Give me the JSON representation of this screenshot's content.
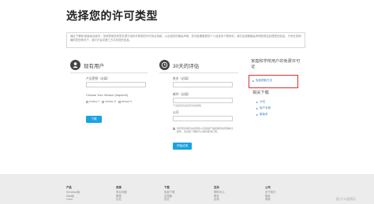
{
  "page": {
    "title": "选择您的许可类型"
  },
  "notice": {
    "text": "通过下载和/或使用此软件，您即表明您同意并遵守该软件附带的许可协议条款。以及相关的隐私声明，您可能需要提供个人信息来下载软件。我们会按照隐私声明的规定处理您的信息。只有在您明确同意的情况下，我们才会向第三方共享您的信息。"
  },
  "existing": {
    "title": "现有用户",
    "serial_label": "产品密钥（必填）",
    "version_label": "Choose Your Version (required)",
    "versions": [
      "Version 7",
      "Version 8",
      "Version 9"
    ],
    "download_label": "下载"
  },
  "trial": {
    "title": "30天的评估",
    "name_label": "姓名（必填）",
    "email_label": "邮件（必填）",
    "email_hint": "下载链接将发送至您的邮箱",
    "company_label": "公司",
    "consent_text": "我同意接收有关此软件以及其他产品和服务的营销电子邮件，并且我了解我可以随时取消订阅。",
    "start_label": "开始试用"
  },
  "sidebar": {
    "free_title": "家庭和学校用户的免费许可证",
    "free_link": "免费获取方法",
    "related_title": "相关下载",
    "related_links": [
      "32位",
      "用户手册",
      "新版本"
    ]
  },
  "footer": {
    "columns": [
      {
        "head": "产品",
        "items": [
          "Windows版",
          "Mac版",
          "Linux"
        ]
      },
      {
        "head": "资源",
        "items": [
          "常见问题",
          "教程",
          "论坛"
        ]
      },
      {
        "head": "下载",
        "items": [
          "免费下载",
          "试用版",
          "历史"
        ]
      },
      {
        "head": "支持",
        "items": [
          "帮助中心",
          "联系",
          "反馈"
        ]
      },
      {
        "head": "公司",
        "items": [
          "关于我们",
          "隐私",
          "条款"
        ]
      }
    ],
    "watermark": "值 什么值得买"
  },
  "colors": {
    "accent": "#1aa3e0",
    "highlight": "#d9312d",
    "link": "#3a7dc2"
  }
}
